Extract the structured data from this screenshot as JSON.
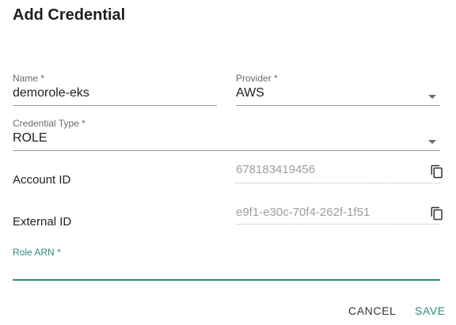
{
  "dialog": {
    "title": "Add Credential",
    "fields": {
      "name": {
        "label": "Name *",
        "value": "demorole-eks"
      },
      "provider": {
        "label": "Provider *",
        "value": "AWS"
      },
      "credential_type": {
        "label": "Credential Type *",
        "value": "ROLE"
      },
      "account_id": {
        "label": "Account ID",
        "value": "678183419456"
      },
      "external_id": {
        "label": "External ID",
        "value": "e9f1-e30c-70f4-262f-1f51"
      },
      "role_arn": {
        "label": "Role ARN *",
        "value": ""
      }
    },
    "actions": {
      "cancel": "CANCEL",
      "save": "SAVE"
    }
  },
  "icons": {
    "copy": "copy-icon",
    "dropdown": "chevron-down-icon"
  },
  "colors": {
    "accent": "#2e8b7a",
    "text": "#212121",
    "label": "#6b6b6b",
    "muted": "#9e9e9e"
  }
}
